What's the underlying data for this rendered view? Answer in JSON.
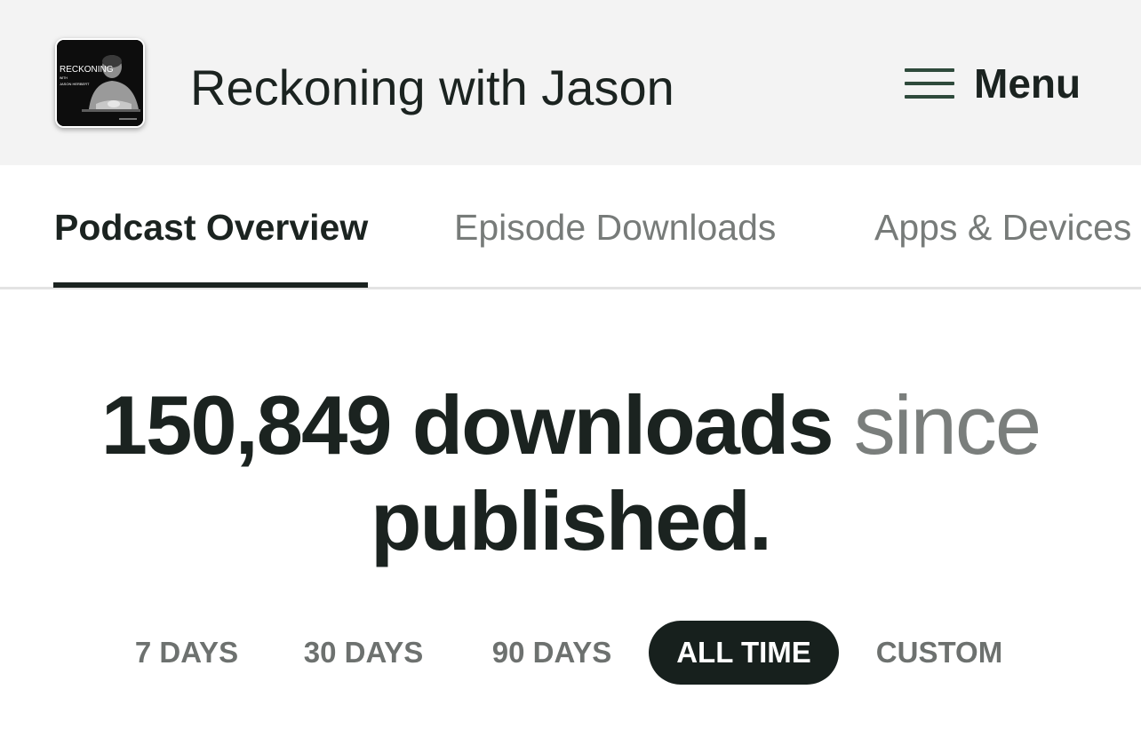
{
  "header": {
    "cover_alt": "Reckoning with Jason Herbert podcast cover",
    "cover_text_main": "RECKONING",
    "cover_text_with": "WITH",
    "cover_text_name": "JASON HERBERT",
    "podcast_title": "Reckoning with Jason",
    "menu_icon": "hamburger-icon",
    "menu_label": "Menu"
  },
  "tabs": [
    {
      "label": "Podcast Overview",
      "active": true
    },
    {
      "label": "Episode Downloads",
      "active": false
    },
    {
      "label": "Apps & Devices",
      "active": false
    }
  ],
  "summary": {
    "downloads_count": "150,849",
    "downloads_word": "downloads",
    "since_word": "since",
    "published_word": "published."
  },
  "time_ranges": [
    {
      "label": "7 DAYS",
      "active": false
    },
    {
      "label": "30 DAYS",
      "active": false
    },
    {
      "label": "90 DAYS",
      "active": false
    },
    {
      "label": "ALL TIME",
      "active": true
    },
    {
      "label": "CUSTOM",
      "active": false
    }
  ],
  "colors": {
    "header_bg": "#f3f3f3",
    "text_dark": "#1b2320",
    "text_muted": "#777b79",
    "active_pill": "#17201d",
    "menu_icon": "#2e4a3b"
  }
}
